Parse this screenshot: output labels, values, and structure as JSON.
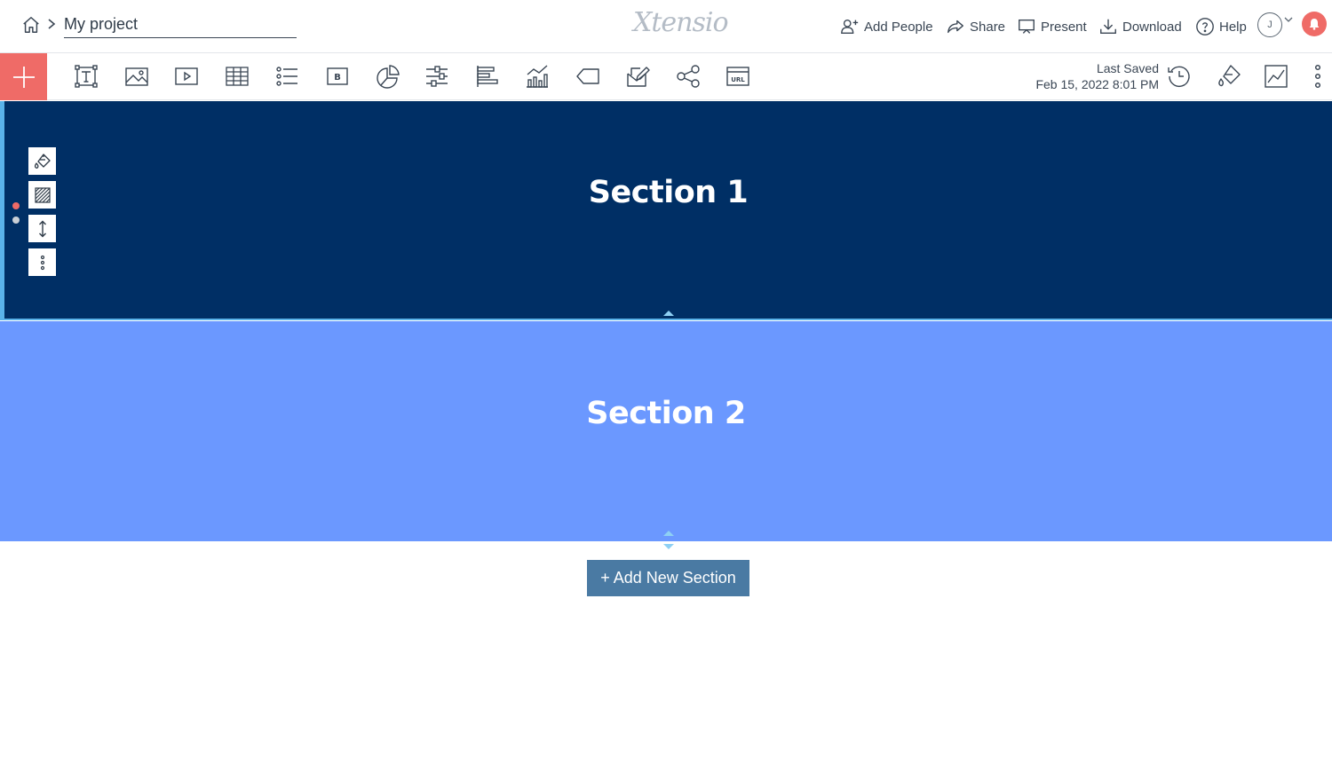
{
  "header": {
    "breadcrumb_home_icon": "home-icon",
    "project_name": "My project",
    "brand": "Xtensio",
    "actions": {
      "add_people": "Add People",
      "share": "Share",
      "present": "Present",
      "download": "Download",
      "help": "Help"
    },
    "avatar_initial": "J"
  },
  "toolbar": {
    "tools": [
      "text-tool-icon",
      "image-tool-icon",
      "video-tool-icon",
      "table-tool-icon",
      "list-tool-icon",
      "button-tool-icon",
      "pie-chart-tool-icon",
      "slider-tool-icon",
      "bar-chart-tool-icon",
      "column-chart-tool-icon",
      "tag-tool-icon",
      "form-tool-icon",
      "share-tool-icon",
      "url-embed-tool-icon"
    ],
    "last_saved_label": "Last Saved",
    "last_saved_time": "Feb 15, 2022 8:01 PM"
  },
  "canvas": {
    "sections": [
      {
        "title": "Section 1",
        "background": "#002f65"
      },
      {
        "title": "Section 2",
        "background": "#6b98ff"
      }
    ],
    "add_section_label": "+ Add New Section"
  },
  "colors": {
    "accent": "#ef6b67",
    "selection": "#5ab3ea",
    "add_section_button": "#4a7aa3"
  }
}
